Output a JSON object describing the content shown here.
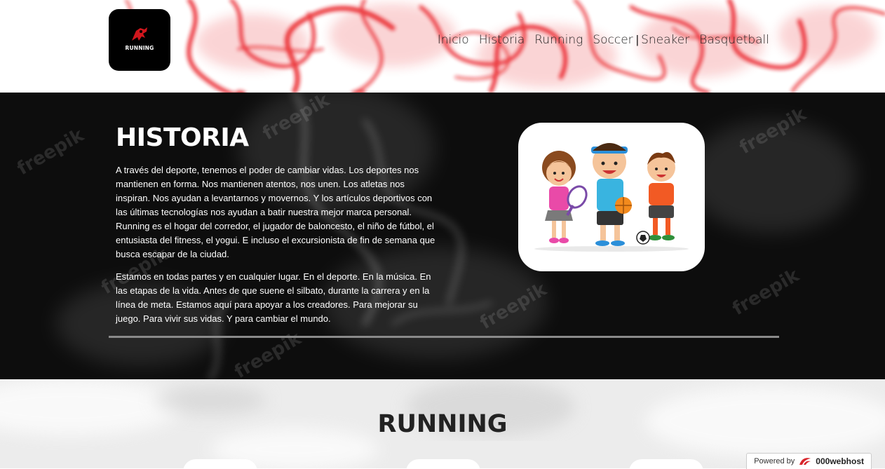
{
  "logo": {
    "text": "RUNNING"
  },
  "nav": {
    "items": [
      "Inicio",
      "Historia",
      "Running",
      "Soccer",
      "Sneaker",
      "Basquetball"
    ],
    "separator": "|"
  },
  "historia": {
    "title": "HISTORIA",
    "paragraph1": "A través del deporte, tenemos el poder de cambiar vidas. Los deportes nos mantienen en forma. Nos mantienen atentos, nos unen. Los atletas nos inspiran. Nos ayudan a levantarnos y movernos. Y los artículos deportivos con las últimas tecnologías nos ayudan a batir nuestra mejor marca personal. Running es el hogar del corredor, el jugador de baloncesto, el niño de fútbol, el entusiasta del fitness, el yogui. E incluso el excursionista de fin de semana que busca escapar de la ciudad.",
    "paragraph2": "Estamos en todas partes y en cualquier lugar. En el deporte. En la música. En las etapas de la vida. Antes de que suene el silbato, durante la carrera y en la línea de meta. Estamos aquí para apoyar a los creadores. Para mejorar su juego. Para vivir sus vidas. Y para cambiar el mundo.",
    "watermark": "freepik"
  },
  "running": {
    "title": "RUNNING"
  },
  "footer_badge": {
    "prefix": "Powered by",
    "host": "000webhost"
  },
  "colors": {
    "accent_red": "#e8141c",
    "dark_bg": "#0d0d0d",
    "light_bg": "#ececec"
  }
}
